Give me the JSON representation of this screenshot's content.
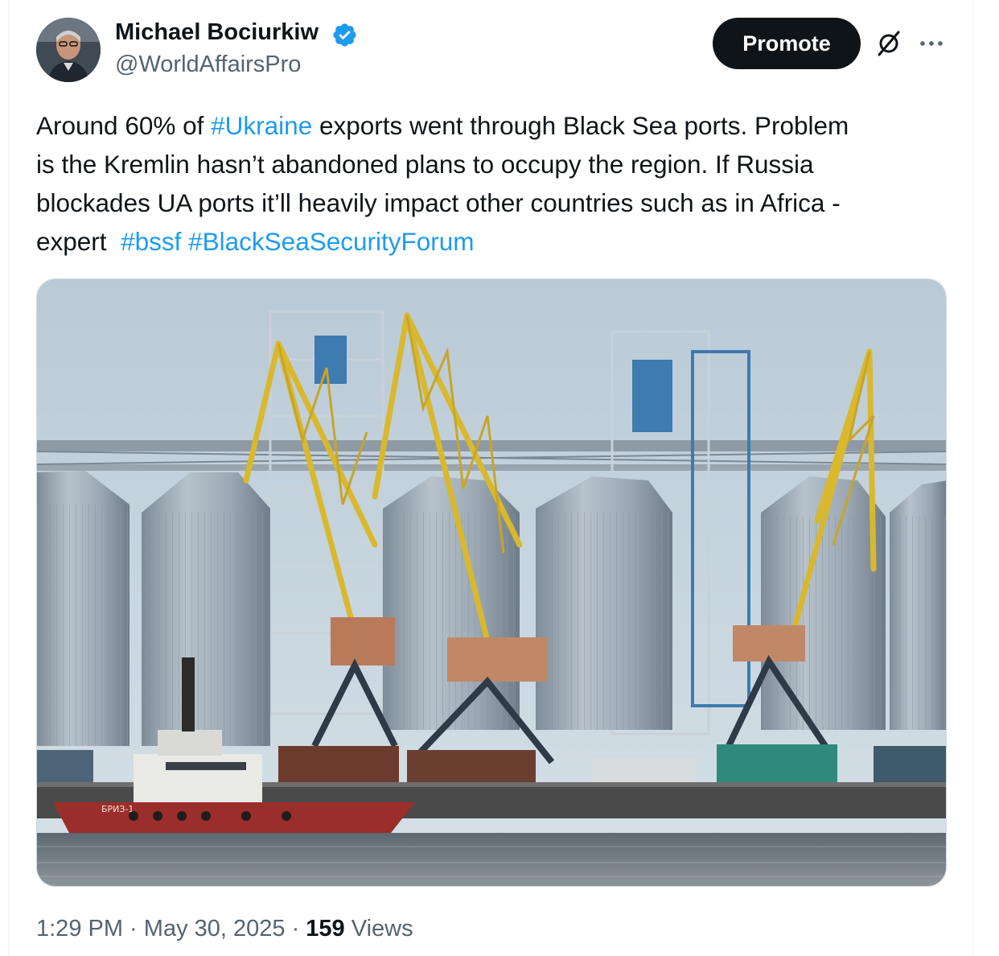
{
  "author": {
    "name": "Michael Bociurkiw",
    "handle": "@WorldAffairsPro",
    "verified": true,
    "verified_color": "#1d9bf0"
  },
  "actions": {
    "promote_label": "Promote",
    "grok_icon": "grok-icon",
    "more_icon": "more-icon"
  },
  "tweet": {
    "line1_a": "Around 60% of ",
    "line1_hashtag": "#Ukraine",
    "line1_b": " exports went through Black Sea ports. Problem",
    "line2": "is the Kremlin hasn’t abandoned plans to occupy the region. If Russia",
    "line3": "blockades UA ports it’ll heavily impact other countries such as in Africa -",
    "line4_a": "expert  ",
    "hashtag_bssf": "#bssf",
    "hashtag_forum": "#BlackSeaSecurityForum",
    "hashtag_color": "#1d9bf0"
  },
  "media": {
    "kind": "photo",
    "subject": "port-cranes-and-grain-silos",
    "vessel_label": "БРИЗ-1"
  },
  "meta": {
    "time": "1:29 PM",
    "separator": " · ",
    "date": "May 30, 2025",
    "views_count": "159",
    "views_label": " Views"
  }
}
